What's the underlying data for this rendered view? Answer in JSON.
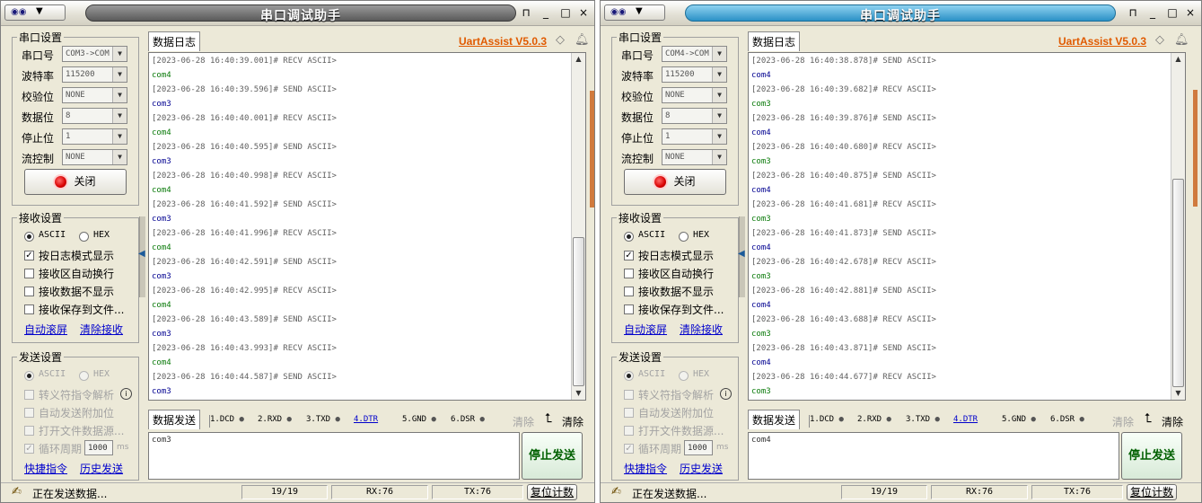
{
  "colors": {
    "accent_brand": "#e05a00",
    "title_active": "#2b91c6",
    "title_inactive": "#5a5a5a",
    "log_device": "#0a7a0a",
    "log_device_blue": "#000090",
    "link": "#0000cc"
  },
  "windows": [
    {
      "title": "串口调试助手",
      "active": false,
      "app_icon": "app-icon",
      "menu_arrow": "▼",
      "titlebar_buttons": {
        "pin": "⊓",
        "min": "_",
        "max": "□",
        "close": "×"
      },
      "serial": {
        "group": "串口设置",
        "port_label": "串口号",
        "port_value": "COM3->COM",
        "baud_label": "波特率",
        "baud_value": "115200",
        "parity_label": "校验位",
        "parity_value": "NONE",
        "databits_label": "数据位",
        "databits_value": "8",
        "stopbits_label": "停止位",
        "stopbits_value": "1",
        "flow_label": "流控制",
        "flow_value": "NONE",
        "close_button": "关闭"
      },
      "recv": {
        "group": "接收设置",
        "ascii": "ASCII",
        "hex": "HEX",
        "log_mode": "按日志模式显示",
        "auto_wrap": "接收区自动换行",
        "hide_data": "接收数据不显示",
        "save_file": "接收保存到文件...",
        "auto_scroll": "自动滚屏",
        "clear_recv": "清除接收"
      },
      "send": {
        "group": "发送设置",
        "ascii": "ASCII",
        "hex": "HEX",
        "escape": "转义符指令解析",
        "append": "自动发送附加位",
        "open_file": "打开文件数据源...",
        "cycle": "循环周期",
        "cycle_value": "1000",
        "cycle_unit": "ms",
        "quick_cmd": "快捷指令",
        "history": "历史发送"
      },
      "log_tab": "数据日志",
      "brand": "UartAssist V5.0.3",
      "log": [
        {
          "t": "[2023-06-28 16:40:39.001]# RECV ASCII>",
          "k": "hdr"
        },
        {
          "t": "com4",
          "k": "dev"
        },
        {
          "t": "[2023-06-28 16:40:39.596]# SEND ASCII>",
          "k": "hdr"
        },
        {
          "t": "com3",
          "k": "dev-blue"
        },
        {
          "t": "[2023-06-28 16:40:40.001]# RECV ASCII>",
          "k": "hdr"
        },
        {
          "t": "com4",
          "k": "dev"
        },
        {
          "t": "[2023-06-28 16:40:40.595]# SEND ASCII>",
          "k": "hdr"
        },
        {
          "t": "com3",
          "k": "dev-blue"
        },
        {
          "t": "[2023-06-28 16:40:40.998]# RECV ASCII>",
          "k": "hdr"
        },
        {
          "t": "com4",
          "k": "dev"
        },
        {
          "t": "[2023-06-28 16:40:41.592]# SEND ASCII>",
          "k": "hdr"
        },
        {
          "t": "com3",
          "k": "dev-blue"
        },
        {
          "t": "[2023-06-28 16:40:41.996]# RECV ASCII>",
          "k": "hdr"
        },
        {
          "t": "com4",
          "k": "dev"
        },
        {
          "t": "[2023-06-28 16:40:42.591]# SEND ASCII>",
          "k": "hdr"
        },
        {
          "t": "com3",
          "k": "dev-blue"
        },
        {
          "t": "[2023-06-28 16:40:42.995]# RECV ASCII>",
          "k": "hdr"
        },
        {
          "t": "com4",
          "k": "dev"
        },
        {
          "t": "[2023-06-28 16:40:43.589]# SEND ASCII>",
          "k": "hdr"
        },
        {
          "t": "com3",
          "k": "dev-blue"
        },
        {
          "t": "[2023-06-28 16:40:43.993]# RECV ASCII>",
          "k": "hdr"
        },
        {
          "t": "com4",
          "k": "dev"
        },
        {
          "t": "[2023-06-28 16:40:44.587]# SEND ASCII>",
          "k": "hdr"
        },
        {
          "t": "com3",
          "k": "dev-blue"
        }
      ],
      "send_tab": "数据发送",
      "pins": [
        "1.DCD",
        "2.RXD",
        "3.TXD",
        "4.DTR",
        "5.GND",
        "6.DSR"
      ],
      "clear_gray": "清除",
      "clear": "清除",
      "send_text": "com3",
      "stop_send": "停止发送",
      "status": {
        "text": "正在发送数据...",
        "count": "19/19",
        "rx": "RX:76",
        "tx": "TX:76",
        "reset": "复位计数"
      }
    },
    {
      "title": "串口调试助手",
      "active": true,
      "app_icon": "app-icon",
      "menu_arrow": "▼",
      "titlebar_buttons": {
        "pin": "⊓",
        "min": "_",
        "max": "□",
        "close": "×"
      },
      "serial": {
        "group": "串口设置",
        "port_label": "串口号",
        "port_value": "COM4->COM",
        "baud_label": "波特率",
        "baud_value": "115200",
        "parity_label": "校验位",
        "parity_value": "NONE",
        "databits_label": "数据位",
        "databits_value": "8",
        "stopbits_label": "停止位",
        "stopbits_value": "1",
        "flow_label": "流控制",
        "flow_value": "NONE",
        "close_button": "关闭"
      },
      "recv": {
        "group": "接收设置",
        "ascii": "ASCII",
        "hex": "HEX",
        "log_mode": "按日志模式显示",
        "auto_wrap": "接收区自动换行",
        "hide_data": "接收数据不显示",
        "save_file": "接收保存到文件...",
        "auto_scroll": "自动滚屏",
        "clear_recv": "清除接收"
      },
      "send": {
        "group": "发送设置",
        "ascii": "ASCII",
        "hex": "HEX",
        "escape": "转义符指令解析",
        "append": "自动发送附加位",
        "open_file": "打开文件数据源...",
        "cycle": "循环周期",
        "cycle_value": "1000",
        "cycle_unit": "ms",
        "quick_cmd": "快捷指令",
        "history": "历史发送"
      },
      "log_tab": "数据日志",
      "brand": "UartAssist V5.0.3",
      "log": [
        {
          "t": "[2023-06-28 16:40:38.878]# SEND ASCII>",
          "k": "hdr"
        },
        {
          "t": "com4",
          "k": "dev-blue"
        },
        {
          "t": "[2023-06-28 16:40:39.682]# RECV ASCII>",
          "k": "hdr"
        },
        {
          "t": "com3",
          "k": "dev"
        },
        {
          "t": "[2023-06-28 16:40:39.876]# SEND ASCII>",
          "k": "hdr"
        },
        {
          "t": "com4",
          "k": "dev-blue"
        },
        {
          "t": "[2023-06-28 16:40:40.680]# RECV ASCII>",
          "k": "hdr"
        },
        {
          "t": "com3",
          "k": "dev"
        },
        {
          "t": "[2023-06-28 16:40:40.875]# SEND ASCII>",
          "k": "hdr"
        },
        {
          "t": "com4",
          "k": "dev-blue"
        },
        {
          "t": "[2023-06-28 16:40:41.681]# RECV ASCII>",
          "k": "hdr"
        },
        {
          "t": "com3",
          "k": "dev"
        },
        {
          "t": "[2023-06-28 16:40:41.873]# SEND ASCII>",
          "k": "hdr"
        },
        {
          "t": "com4",
          "k": "dev-blue"
        },
        {
          "t": "[2023-06-28 16:40:42.678]# RECV ASCII>",
          "k": "hdr"
        },
        {
          "t": "com3",
          "k": "dev"
        },
        {
          "t": "[2023-06-28 16:40:42.881]# SEND ASCII>",
          "k": "hdr"
        },
        {
          "t": "com4",
          "k": "dev-blue"
        },
        {
          "t": "[2023-06-28 16:40:43.688]# RECV ASCII>",
          "k": "hdr"
        },
        {
          "t": "com3",
          "k": "dev"
        },
        {
          "t": "[2023-06-28 16:40:43.871]# SEND ASCII>",
          "k": "hdr"
        },
        {
          "t": "com4",
          "k": "dev-blue"
        },
        {
          "t": "[2023-06-28 16:40:44.677]# RECV ASCII>",
          "k": "hdr"
        },
        {
          "t": "com3",
          "k": "dev"
        }
      ],
      "send_tab": "数据发送",
      "pins": [
        "1.DCD",
        "2.RXD",
        "3.TXD",
        "4.DTR",
        "5.GND",
        "6.DSR"
      ],
      "clear_gray": "清除",
      "clear": "清除",
      "send_text": "com4",
      "stop_send": "停止发送",
      "status": {
        "text": "正在发送数据...",
        "count": "19/19",
        "rx": "RX:76",
        "tx": "TX:76",
        "reset": "复位计数"
      }
    }
  ]
}
